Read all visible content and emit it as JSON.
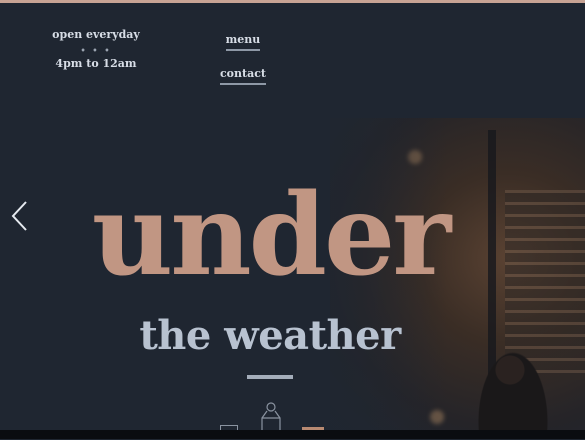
{
  "hours": {
    "line1": "open everyday",
    "dots": "• • •",
    "line2": "4pm to 12am"
  },
  "nav": {
    "menu_label": "menu",
    "contact_label": "contact"
  },
  "hero": {
    "title": "under",
    "subtitle": "the weather"
  },
  "icons": {
    "carousel_prev": "chevron-left-icon",
    "scroll_decoration": "lantern-icon"
  },
  "colors": {
    "background": "#1f2631",
    "accent": "#c19683",
    "text": "#d7dde6",
    "subtitle": "#b8c2d0"
  }
}
